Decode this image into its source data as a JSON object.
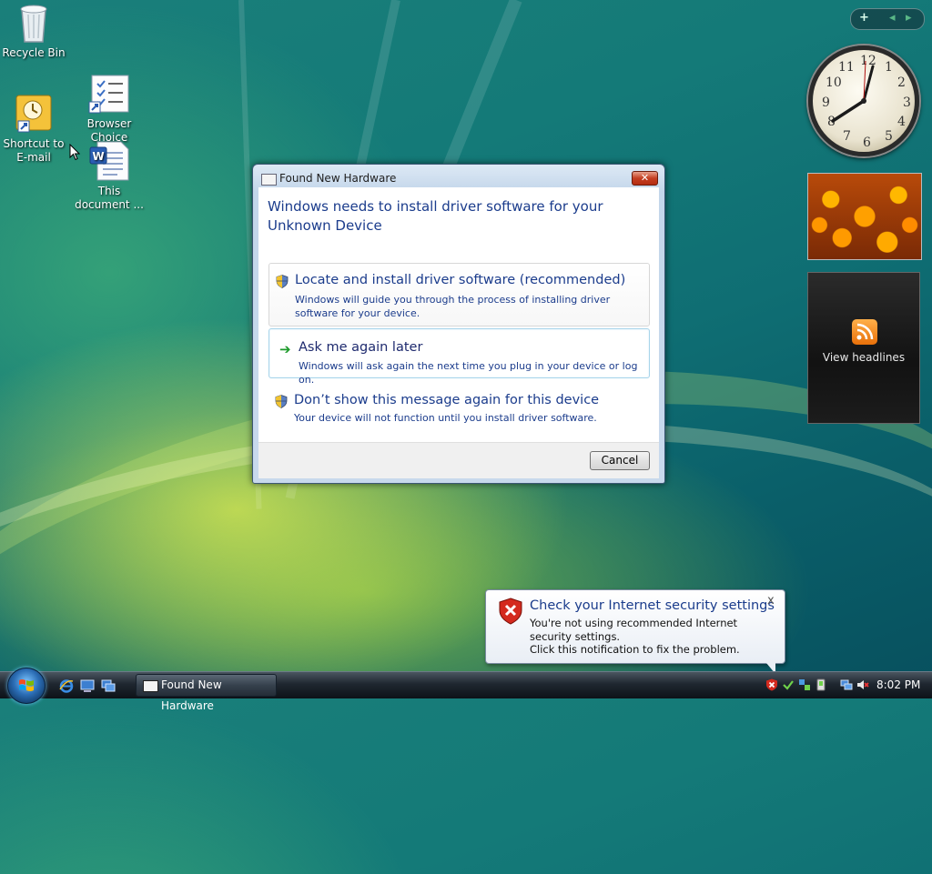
{
  "desktop": {
    "icons": [
      {
        "label": "Recycle Bin"
      },
      {
        "label": "Shortcut to E-mail"
      },
      {
        "label": "Browser Choice"
      },
      {
        "label": "This document ..."
      }
    ]
  },
  "sidebar": {
    "controls": {
      "add": "+",
      "prev": "◂",
      "next": "▸"
    },
    "clock_numbers": [
      "12",
      "1",
      "2",
      "3",
      "4",
      "5",
      "6",
      "7",
      "8",
      "9",
      "10",
      "11"
    ],
    "feed_label": "View headlines"
  },
  "dialog": {
    "title": "Found New Hardware",
    "close_label": "✕",
    "heading": "Windows needs to install driver software for your Unknown Device",
    "options": [
      {
        "main": "Locate and install driver software (recommended)",
        "sub": "Windows will guide you through the process of installing driver software for your device."
      },
      {
        "main": "Ask me again later",
        "sub": "Windows will ask again the next time you plug in your device or log on."
      },
      {
        "main": "Don’t show this message again for this device",
        "sub": "Your device will not function until you install driver software."
      }
    ],
    "cancel_label": "Cancel"
  },
  "notification": {
    "title": "Check your Internet security settings",
    "text_line1": "You're not using recommended Internet security settings.",
    "text_line2": "Click this notification to fix the problem.",
    "close_label": "x"
  },
  "taskbar": {
    "task_label": "Found New Hardware",
    "time": "8:02 PM"
  },
  "colors": {
    "heading_blue": "#1b3c8c",
    "arrow_green": "#1c9a2a",
    "close_red": "#c43f22"
  }
}
